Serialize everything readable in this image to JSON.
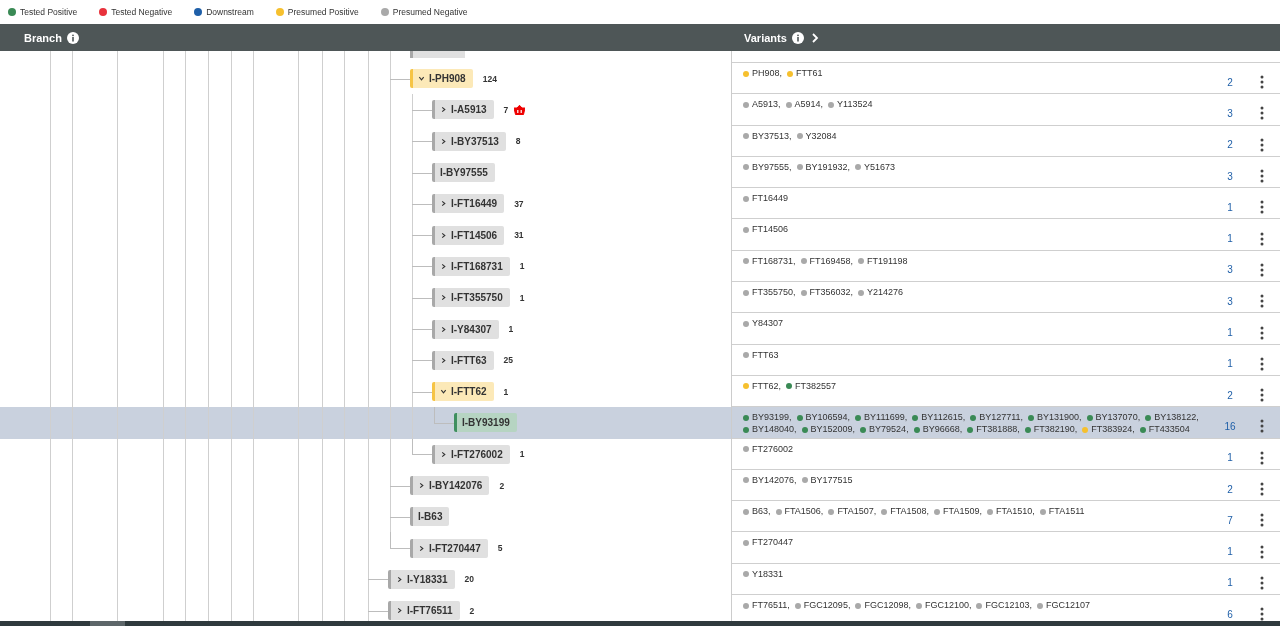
{
  "legend": [
    {
      "label": "Tested Positive",
      "color": "#3a8a55"
    },
    {
      "label": "Tested Negative",
      "color": "#e8323c"
    },
    {
      "label": "Downstream",
      "color": "#1f5fa8"
    },
    {
      "label": "Presumed Positive",
      "color": "#f6c02e"
    },
    {
      "label": "Presumed Negative",
      "color": "#a9a9a9"
    }
  ],
  "header": {
    "branch_title": "Branch",
    "variants_title": "Variants"
  },
  "tree": [
    {
      "children": [
        {
          "label": "I-PH908",
          "count": "124",
          "expandable": true,
          "expanded": true,
          "color": "#f6c445",
          "selected": false,
          "variant_count": "2",
          "variants": [
            {
              "name": "PH908,",
              "color": "#f6c02e"
            },
            {
              "name": "FTT61",
              "color": "#f6c02e"
            }
          ],
          "children": [
            {
              "label": "I-A5913",
              "count": "7",
              "basket": true,
              "expandable": true,
              "expanded": false,
              "color": "#a8a8a8",
              "selected": false,
              "variant_count": "3",
              "variants": [
                {
                  "name": "A5913,",
                  "color": "#a9a9a9"
                },
                {
                  "name": "A5914,",
                  "color": "#a9a9a9"
                },
                {
                  "name": "Y113524",
                  "color": "#a9a9a9"
                }
              ]
            },
            {
              "label": "I-BY37513",
              "count": "8",
              "expandable": true,
              "expanded": false,
              "color": "#a8a8a8",
              "selected": false,
              "variant_count": "2",
              "variants": [
                {
                  "name": "BY37513,",
                  "color": "#a9a9a9"
                },
                {
                  "name": "Y32084",
                  "color": "#a9a9a9"
                }
              ]
            },
            {
              "label": "I-BY97555",
              "expandable": false,
              "color": "#a8a8a8",
              "selected": false,
              "variant_count": "3",
              "variants": [
                {
                  "name": "BY97555,",
                  "color": "#a9a9a9"
                },
                {
                  "name": "BY191932,",
                  "color": "#a9a9a9"
                },
                {
                  "name": "Y51673",
                  "color": "#a9a9a9"
                }
              ]
            },
            {
              "label": "I-FT16449",
              "count": "37",
              "expandable": true,
              "expanded": false,
              "color": "#a8a8a8",
              "selected": false,
              "variant_count": "1",
              "variants": [
                {
                  "name": "FT16449",
                  "color": "#a9a9a9"
                }
              ]
            },
            {
              "label": "I-FT14506",
              "count": "31",
              "expandable": true,
              "expanded": false,
              "color": "#a8a8a8",
              "selected": false,
              "variant_count": "1",
              "variants": [
                {
                  "name": "FT14506",
                  "color": "#a9a9a9"
                }
              ]
            },
            {
              "label": "I-FT168731",
              "count": "1",
              "expandable": true,
              "expanded": false,
              "color": "#a8a8a8",
              "selected": false,
              "variant_count": "3",
              "variants": [
                {
                  "name": "FT168731,",
                  "color": "#a9a9a9"
                },
                {
                  "name": "FT169458,",
                  "color": "#a9a9a9"
                },
                {
                  "name": "FT191198",
                  "color": "#a9a9a9"
                }
              ]
            },
            {
              "label": "I-FT355750",
              "count": "1",
              "expandable": true,
              "expanded": false,
              "color": "#a8a8a8",
              "selected": false,
              "variant_count": "3",
              "variants": [
                {
                  "name": "FT355750,",
                  "color": "#a9a9a9"
                },
                {
                  "name": "FT356032,",
                  "color": "#a9a9a9"
                },
                {
                  "name": "Y214276",
                  "color": "#a9a9a9"
                }
              ]
            },
            {
              "label": "I-Y84307",
              "count": "1",
              "expandable": true,
              "expanded": false,
              "color": "#a8a8a8",
              "selected": false,
              "variant_count": "1",
              "variants": [
                {
                  "name": "Y84307",
                  "color": "#a9a9a9"
                }
              ]
            },
            {
              "label": "I-FTT63",
              "count": "25",
              "expandable": true,
              "expanded": false,
              "color": "#a8a8a8",
              "selected": false,
              "variant_count": "1",
              "variants": [
                {
                  "name": "FTT63",
                  "color": "#a9a9a9"
                }
              ]
            },
            {
              "label": "I-FTT62",
              "count": "1",
              "expandable": true,
              "expanded": true,
              "color": "#f6c445",
              "selected": false,
              "variant_count": "2",
              "variants": [
                {
                  "name": "FTT62,",
                  "color": "#f6c02e"
                },
                {
                  "name": "FT382557",
                  "color": "#3a8a55"
                }
              ],
              "children": [
                {
                  "label": "I-BY93199",
                  "expandable": false,
                  "color": "#3f8f5f",
                  "selected": true,
                  "variant_count": "16",
                  "variants": [
                    {
                      "name": "BY93199,",
                      "color": "#3a8a55"
                    },
                    {
                      "name": "BY106594,",
                      "color": "#3a8a55"
                    },
                    {
                      "name": "BY111699,",
                      "color": "#3a8a55"
                    },
                    {
                      "name": "BY112615,",
                      "color": "#3a8a55"
                    },
                    {
                      "name": "BY127711,",
                      "color": "#3a8a55"
                    },
                    {
                      "name": "BY131900,",
                      "color": "#3a8a55"
                    },
                    {
                      "name": "BY137070,",
                      "color": "#3a8a55"
                    },
                    {
                      "name": "BY138122,",
                      "color": "#3a8a55"
                    },
                    {
                      "name": "BY148040,",
                      "color": "#3a8a55"
                    },
                    {
                      "name": "BY152009,",
                      "color": "#3a8a55"
                    },
                    {
                      "name": "BY79524,",
                      "color": "#3a8a55"
                    },
                    {
                      "name": "BY96668,",
                      "color": "#3a8a55"
                    },
                    {
                      "name": "FT381888,",
                      "color": "#3a8a55"
                    },
                    {
                      "name": "FT382190,",
                      "color": "#3a8a55"
                    },
                    {
                      "name": "FT383924,",
                      "color": "#f6c02e"
                    },
                    {
                      "name": "FT433504",
                      "color": "#3a8a55"
                    }
                  ]
                }
              ]
            },
            {
              "label": "I-FT276002",
              "count": "1",
              "expandable": true,
              "expanded": false,
              "color": "#a8a8a8",
              "selected": false,
              "variant_count": "1",
              "variants": [
                {
                  "name": "FT276002",
                  "color": "#a9a9a9"
                }
              ]
            }
          ]
        },
        {
          "label": "I-BY142076",
          "count": "2",
          "expandable": true,
          "expanded": false,
          "color": "#a8a8a8",
          "selected": false,
          "variant_count": "2",
          "variants": [
            {
              "name": "BY142076,",
              "color": "#a9a9a9"
            },
            {
              "name": "BY177515",
              "color": "#a9a9a9"
            }
          ]
        },
        {
          "label": "I-B63",
          "expandable": false,
          "color": "#a8a8a8",
          "selected": false,
          "variant_count": "7",
          "variants": [
            {
              "name": "B63,",
              "color": "#a9a9a9"
            },
            {
              "name": "FTA1506,",
              "color": "#a9a9a9"
            },
            {
              "name": "FTA1507,",
              "color": "#a9a9a9"
            },
            {
              "name": "FTA1508,",
              "color": "#a9a9a9"
            },
            {
              "name": "FTA1509,",
              "color": "#a9a9a9"
            },
            {
              "name": "FTA1510,",
              "color": "#a9a9a9"
            },
            {
              "name": "FTA1511",
              "color": "#a9a9a9"
            }
          ]
        },
        {
          "label": "I-FT270447",
          "count": "5",
          "expandable": true,
          "expanded": false,
          "color": "#a8a8a8",
          "selected": false,
          "variant_count": "1",
          "variants": [
            {
              "name": "FT270447",
              "color": "#a9a9a9"
            }
          ]
        }
      ]
    },
    {
      "label": "I-Y18331",
      "count": "20",
      "expandable": true,
      "expanded": false,
      "color": "#a8a8a8",
      "selected": false,
      "variant_count": "1",
      "variants": [
        {
          "name": "Y18331",
          "color": "#a9a9a9"
        }
      ]
    },
    {
      "label": "I-FT76511",
      "count": "2",
      "expandable": true,
      "expanded": false,
      "color": "#a8a8a8",
      "selected": false,
      "variant_count": "6",
      "variants": [
        {
          "name": "FT76511,",
          "color": "#a9a9a9"
        },
        {
          "name": "FGC12095,",
          "color": "#a9a9a9"
        },
        {
          "name": "FGC12098,",
          "color": "#a9a9a9"
        },
        {
          "name": "FGC12100,",
          "color": "#a9a9a9"
        },
        {
          "name": "FGC12103,",
          "color": "#a9a9a9"
        },
        {
          "name": "FGC12107",
          "color": "#a9a9a9"
        }
      ]
    }
  ]
}
